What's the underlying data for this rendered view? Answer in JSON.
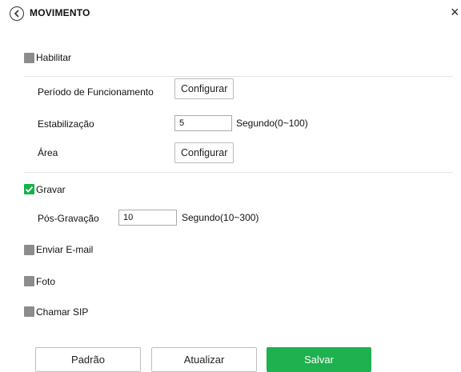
{
  "header": {
    "title": "MOVIMENTO",
    "close_symbol": "×"
  },
  "habilitar": {
    "label": "Habilitar",
    "checked": false
  },
  "periodo": {
    "label": "Período de Funcionamento",
    "button": "Configurar"
  },
  "estabilizacao": {
    "label": "Estabilização",
    "value": "5",
    "unit": "Segundo(0~100)"
  },
  "area": {
    "label": "Área",
    "button": "Configurar"
  },
  "gravar": {
    "label": "Gravar",
    "checked": true
  },
  "pos_gravacao": {
    "label": "Pós-Gravação",
    "value": "10",
    "unit": "Segundo(10~300)"
  },
  "enviar_email": {
    "label": "Enviar E-mail",
    "checked": false
  },
  "foto": {
    "label": "Foto",
    "checked": false
  },
  "chamar_sip": {
    "label": "Chamar SIP",
    "checked": false
  },
  "footer": {
    "padrao": "Padrão",
    "atualizar": "Atualizar",
    "salvar": "Salvar"
  },
  "colors": {
    "accent_green": "#1fb04f",
    "checkbox_gray": "#8c8c8c"
  },
  "icons": {
    "back": "chevron-left-circle-icon",
    "close": "close-icon",
    "check": "checkmark-icon"
  }
}
